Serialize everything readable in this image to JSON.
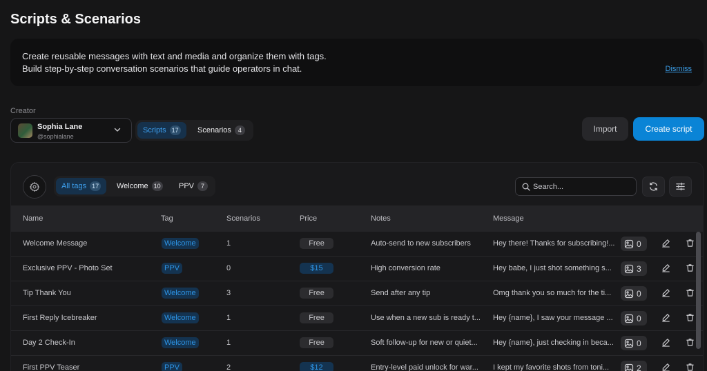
{
  "page": {
    "title": "Scripts & Scenarios"
  },
  "banner": {
    "line1": "Create reusable messages with text and media and organize them with tags.",
    "line2": "Build step-by-step conversation scenarios that guide operators in chat.",
    "dismiss": "Dismiss"
  },
  "creator": {
    "label": "Creator",
    "name": "Sophia Lane",
    "handle": "@sophialane"
  },
  "mode_tabs": [
    {
      "label": "Scripts",
      "count": "17",
      "active": true
    },
    {
      "label": "Scenarios",
      "count": "4",
      "active": false
    }
  ],
  "actions": {
    "import": "Import",
    "create": "Create script"
  },
  "tag_filters": [
    {
      "label": "All tags",
      "count": "17",
      "active": true
    },
    {
      "label": "Welcome",
      "count": "10",
      "active": false
    },
    {
      "label": "PPV",
      "count": "7",
      "active": false
    }
  ],
  "search": {
    "placeholder": "Search...",
    "value": ""
  },
  "columns": [
    "Name",
    "Tag",
    "Scenarios",
    "Price",
    "Notes",
    "Message"
  ],
  "rows": [
    {
      "name": "Welcome Message",
      "tag": "Welcome",
      "scenarios": "1",
      "price": "Free",
      "notes": "Auto-send to new subscribers",
      "message": "Hey there! Thanks for subscribing!...",
      "media": "0"
    },
    {
      "name": "Exclusive PPV - Photo Set",
      "tag": "PPV",
      "scenarios": "0",
      "price": "$15",
      "notes": "High conversion rate",
      "message": "Hey babe, I just shot something s...",
      "media": "3"
    },
    {
      "name": "Tip Thank You",
      "tag": "Welcome",
      "scenarios": "3",
      "price": "Free",
      "notes": "Send after any tip",
      "message": "Omg thank you so much for the ti...",
      "media": "0"
    },
    {
      "name": "First Reply Icebreaker",
      "tag": "Welcome",
      "scenarios": "1",
      "price": "Free",
      "notes": "Use when a new sub is ready t...",
      "message": "Hey {name}, I saw your message ...",
      "media": "0"
    },
    {
      "name": "Day 2 Check-In",
      "tag": "Welcome",
      "scenarios": "1",
      "price": "Free",
      "notes": "Soft follow-up for new or quiet...",
      "message": "Hey {name}, just checking in beca...",
      "media": "0"
    },
    {
      "name": "First PPV Teaser",
      "tag": "PPV",
      "scenarios": "2",
      "price": "$12",
      "notes": "Entry-level paid unlock for war...",
      "message": "I kept my favorite shots from toni...",
      "media": "2"
    }
  ],
  "colors": {
    "accent": "#0a84d6",
    "tag_text": "#2e95e6",
    "tag_bg": "#143350",
    "background": "#161617"
  },
  "icons": [
    "settings-icon",
    "search-icon",
    "refresh-icon",
    "filter-sliders-icon",
    "image-icon",
    "edit-icon",
    "trash-icon",
    "chevron-down-icon"
  ]
}
